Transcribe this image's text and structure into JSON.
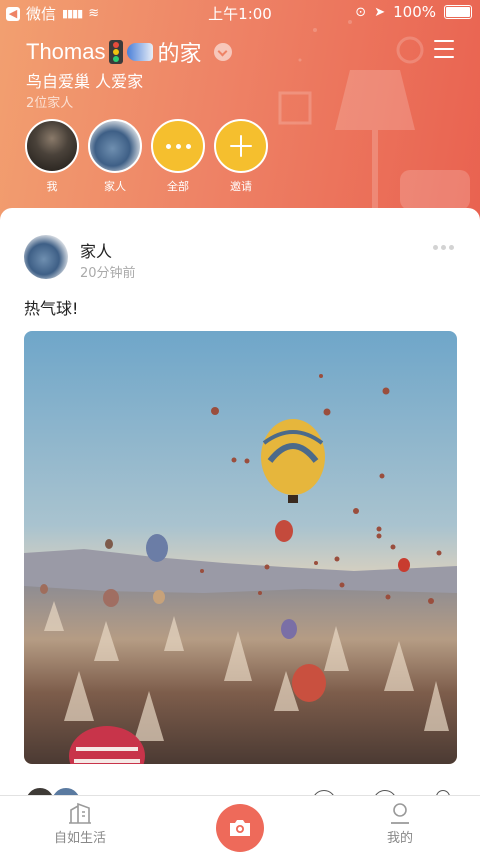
{
  "status_bar": {
    "carrier": "微信",
    "time": "上午1:00",
    "battery": "100%"
  },
  "header": {
    "family_name_prefix": "Thomas",
    "family_name_suffix": "的家",
    "motto": "鸟自爱巢 人爱家",
    "member_count": "2位家人",
    "members": [
      {
        "label": "我"
      },
      {
        "label": "家人"
      },
      {
        "label": "全部"
      },
      {
        "label": "邀请"
      }
    ]
  },
  "post": {
    "author": "家人",
    "time": "20分钟前",
    "text": "热气球!"
  },
  "tabbar": {
    "left_label": "自如生活",
    "right_label": "我的"
  },
  "colors": {
    "header_start": "#f2a070",
    "header_end": "#e96250",
    "accent_yellow": "#f5bf2e",
    "camera_button": "#ee6a5a"
  }
}
